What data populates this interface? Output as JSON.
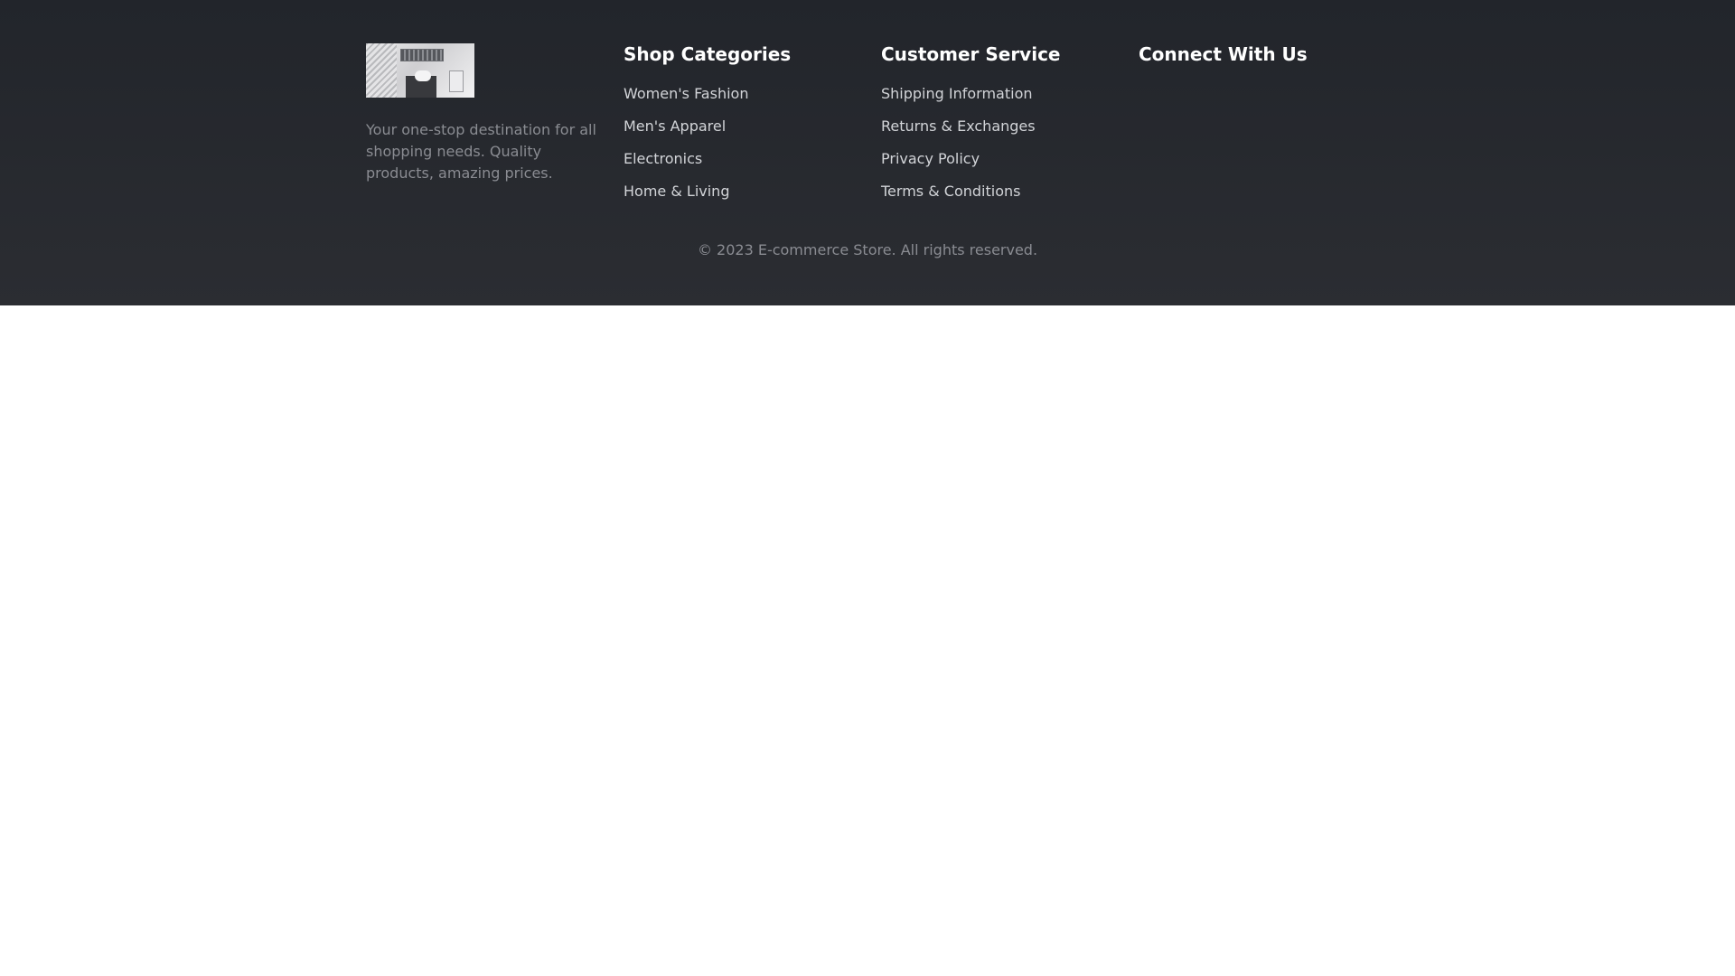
{
  "footer": {
    "brand": {
      "logo_icon": "shopping-laptop-photo-logo",
      "tagline": "Your one-stop destination for all shopping needs. Quality products, amazing prices."
    },
    "shop": {
      "title": "Shop Categories",
      "links": [
        "Women's Fashion",
        "Men's Apparel",
        "Electronics",
        "Home & Living"
      ]
    },
    "service": {
      "title": "Customer Service",
      "links": [
        "Shipping Information",
        "Returns & Exchanges",
        "Privacy Policy",
        "Terms & Conditions"
      ]
    },
    "connect": {
      "title": "Connect With Us"
    },
    "copyright": "© 2023 E-commerce Store. All rights reserved."
  },
  "colors": {
    "footer_background": "#25282d",
    "heading": "#ffffff",
    "link": "#d2d4d8",
    "muted_text": "#8a8c92",
    "page_background": "#ffffff"
  }
}
